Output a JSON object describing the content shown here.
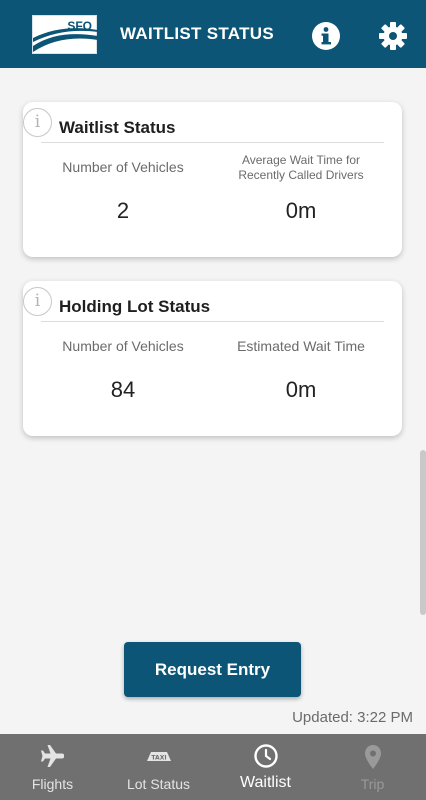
{
  "header": {
    "logo_text": "SFO",
    "title": "WAITLIST STATUS",
    "info_icon": "info-circle-icon",
    "settings_icon": "gear-icon",
    "background_color": "#0c5576"
  },
  "waitlist_card": {
    "title": "Waitlist Status",
    "info_glyph": "i",
    "left_label": "Number of Vehicles",
    "left_value": "2",
    "right_label_line1": "Average Wait Time for",
    "right_label_line2": "Recently Called Drivers",
    "right_value": "0m"
  },
  "holding_card": {
    "title": "Holding Lot Status",
    "info_glyph": "i",
    "left_label": "Number of Vehicles",
    "left_value": "84",
    "right_label": "Estimated Wait Time",
    "right_value": "0m"
  },
  "request_button": {
    "label": "Request Entry",
    "color": "#0c5576"
  },
  "updated_text": "Updated: 3:22 PM",
  "tabbar": {
    "tabs": [
      {
        "label": "Flights",
        "icon": "airplane-icon",
        "state": "normal"
      },
      {
        "label": "Lot Status",
        "icon": "taxi-sign-icon",
        "icon_text": "TAXI",
        "state": "normal"
      },
      {
        "label": "Waitlist",
        "icon": "clock-icon",
        "state": "active"
      },
      {
        "label": "Trip",
        "icon": "map-pin-icon",
        "state": "disabled"
      }
    ]
  }
}
